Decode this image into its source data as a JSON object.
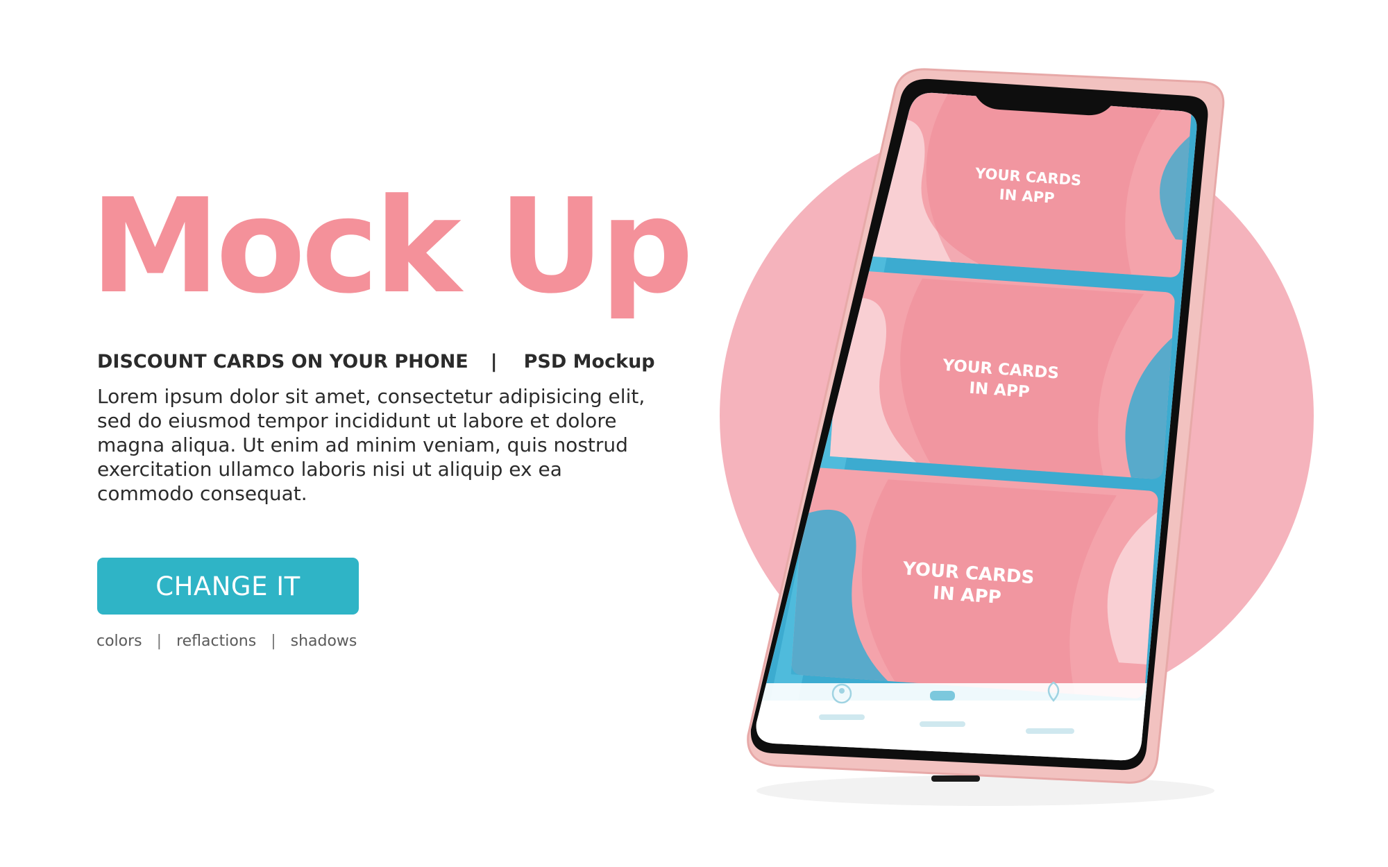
{
  "hero": {
    "title": "Mock Up",
    "subtitle_left": "DISCOUNT CARDS ON YOUR PHONE",
    "subtitle_separator": "|",
    "subtitle_right": "PSD Mockup",
    "body": "Lorem ipsum dolor sit amet, consectetur adipisicing elit, sed do eiusmod tempor incididunt ut labore et dolore magna aliqua. Ut enim ad minim veniam, quis nostrud exercitation ullamco laboris nisi ut aliquip ex ea commodo consequat."
  },
  "cta": {
    "label": "CHANGE IT"
  },
  "links": {
    "items": [
      "colors",
      "reflactions",
      "shadows"
    ],
    "separator": "|"
  },
  "phone": {
    "cards": [
      {
        "line1": "YOUR CARDS",
        "line2": "IN APP"
      },
      {
        "line1": "YOUR CARDS",
        "line2": "IN APP"
      },
      {
        "line1": "YOUR CARDS",
        "line2": "IN APP"
      }
    ],
    "tabs": [
      {
        "icon": "user-icon"
      },
      {
        "icon": "card-icon"
      },
      {
        "icon": "location-pin-icon"
      }
    ]
  },
  "colors": {
    "brand_pink": "#f4919a",
    "accent_teal": "#2fb4c6",
    "card_blue": "#3cabd0",
    "phone_frame": "#f2c2c0",
    "text_dark": "#2b2b2b",
    "text_muted": "#5a5a5a"
  }
}
